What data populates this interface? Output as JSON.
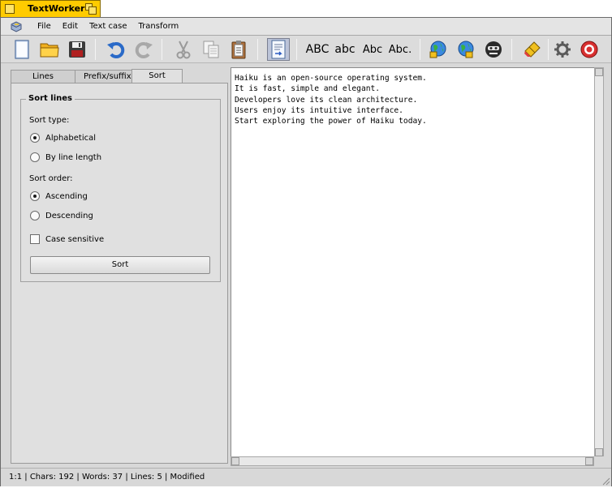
{
  "window": {
    "title": "TextWorker"
  },
  "menu": {
    "app_icon": "app-menu-icon",
    "items": [
      "File",
      "Edit",
      "Text case",
      "Transform"
    ]
  },
  "toolbar": {
    "buttons": [
      {
        "name": "new-document-icon"
      },
      {
        "name": "open-folder-icon"
      },
      {
        "name": "save-disk-icon"
      },
      {
        "name": "undo-icon"
      },
      {
        "name": "redo-icon"
      },
      {
        "name": "cut-icon"
      },
      {
        "name": "copy-icon"
      },
      {
        "name": "paste-icon"
      },
      {
        "name": "word-wrap-icon"
      },
      {
        "name": "uppercase-icon",
        "text": "ABC"
      },
      {
        "name": "lowercase-icon",
        "text": "abc"
      },
      {
        "name": "titlecase-icon",
        "text": "Abc"
      },
      {
        "name": "sentencecase-icon",
        "text": "Abc."
      },
      {
        "name": "url-encode-icon"
      },
      {
        "name": "url-decode-icon"
      },
      {
        "name": "rot13-icon"
      },
      {
        "name": "clear-icon"
      },
      {
        "name": "settings-icon"
      },
      {
        "name": "quit-icon"
      }
    ]
  },
  "tabs": [
    {
      "label": "Lines",
      "selected": false
    },
    {
      "label": "Prefix/suffix",
      "selected": false
    },
    {
      "label": "Sort lines",
      "selected": true
    }
  ],
  "sort_panel": {
    "group_title": "Sort lines",
    "sort_type_label": "Sort type:",
    "type_alphabetical": "Alphabetical",
    "type_by_length": "By line length",
    "sort_order_label": "Sort order:",
    "order_ascending": "Ascending",
    "order_descending": "Descending",
    "case_sensitive": "Case sensitive",
    "sort_button": "Sort"
  },
  "editor": {
    "text": "Haiku is an open-source operating system.\nIt is fast, simple and elegant.\nDevelopers love its clean architecture.\nUsers enjoy its intuitive interface.\nStart exploring the power of Haiku today."
  },
  "status": {
    "text": "1:1 | Chars: 192 | Words: 37 | Lines: 5 | Modified"
  }
}
